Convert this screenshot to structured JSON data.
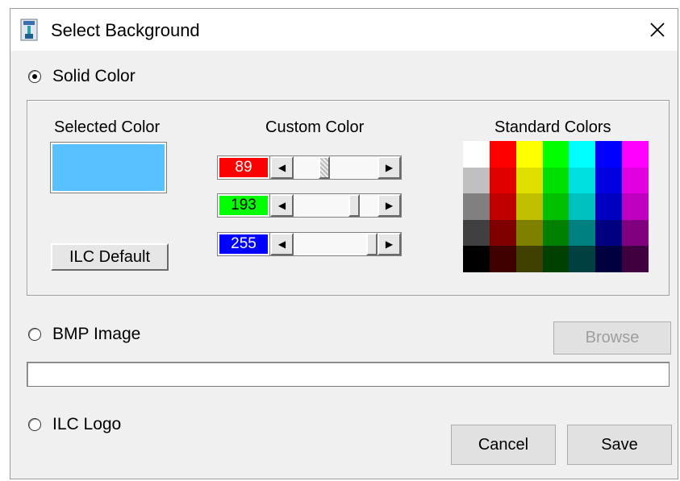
{
  "window": {
    "title": "Select Background"
  },
  "modes": {
    "solid": {
      "label": "Solid Color",
      "checked": true
    },
    "bmp": {
      "label": "BMP Image",
      "checked": false
    },
    "logo": {
      "label": "ILC Logo",
      "checked": false
    }
  },
  "selected_color": {
    "label": "Selected Color",
    "value": "#59c1ff"
  },
  "ilc_default_label": "ILC Default",
  "custom_color": {
    "label": "Custom Color",
    "channels": [
      {
        "name": "red",
        "value": "89",
        "bg": "#ff0000",
        "fg": "#ffffff",
        "fraction": 0.349
      },
      {
        "name": "green",
        "value": "193",
        "bg": "#00ff00",
        "fg": "#000000",
        "fraction": 0.757
      },
      {
        "name": "blue",
        "value": "255",
        "bg": "#0000ff",
        "fg": "#ffffff",
        "fraction": 1.0
      }
    ]
  },
  "standard_colors": {
    "label": "Standard Colors",
    "rows": [
      [
        "#ffffff",
        "#ff0000",
        "#ffff00",
        "#00ff00",
        "#00ffff",
        "#0000ff",
        "#ff00ff"
      ],
      [
        "#c0c0c0",
        "#e00000",
        "#e0e000",
        "#00e000",
        "#00e0e0",
        "#0000e0",
        "#e000e0"
      ],
      [
        "#808080",
        "#c00000",
        "#c0c000",
        "#00c000",
        "#00c0c0",
        "#0000c0",
        "#c000c0"
      ],
      [
        "#404040",
        "#800000",
        "#808000",
        "#008000",
        "#008080",
        "#000080",
        "#800080"
      ],
      [
        "#000000",
        "#400000",
        "#404000",
        "#004000",
        "#004040",
        "#000040",
        "#400040"
      ]
    ]
  },
  "browse_label": "Browse",
  "bmp_path": "",
  "cancel_label": "Cancel",
  "save_label": "Save",
  "icons": {
    "app": "paint-tool-icon",
    "close": "close-icon"
  }
}
